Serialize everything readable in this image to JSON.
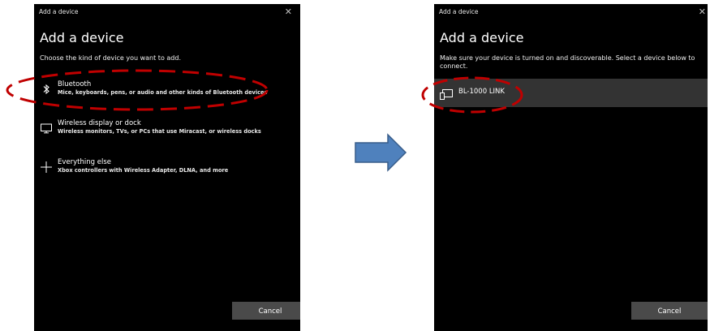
{
  "left_window": {
    "title": "Add a device",
    "close_glyph": "✕",
    "heading": "Add a device",
    "instruction": "Choose the kind of device you want to add.",
    "options": [
      {
        "icon": "bluetooth-icon",
        "title": "Bluetooth",
        "description": "Mice, keyboards, pens, or audio and other kinds of Bluetooth devices"
      },
      {
        "icon": "monitor-icon",
        "title": "Wireless display or dock",
        "description": "Wireless monitors, TVs, or PCs that use Miracast, or wireless docks"
      },
      {
        "icon": "plus-icon",
        "title": "Everything else",
        "description": "Xbox controllers with Wireless Adapter, DLNA, and more"
      }
    ],
    "cancel_label": "Cancel"
  },
  "right_window": {
    "title": "Add a device",
    "close_glyph": "✕",
    "heading": "Add a device",
    "instruction": "Make sure your device is turned on and discoverable. Select a device below to connect.",
    "devices": [
      {
        "icon": "device-icon",
        "name": "BL-1000 LINK"
      }
    ],
    "cancel_label": "Cancel"
  },
  "colors": {
    "window_bg": "#000000",
    "highlight_ellipse": "#c00000",
    "arrow_fill": "#4f81bd",
    "arrow_stroke": "#385d8a",
    "selected_row": "#333333",
    "button_bg": "#4a4a4a"
  }
}
